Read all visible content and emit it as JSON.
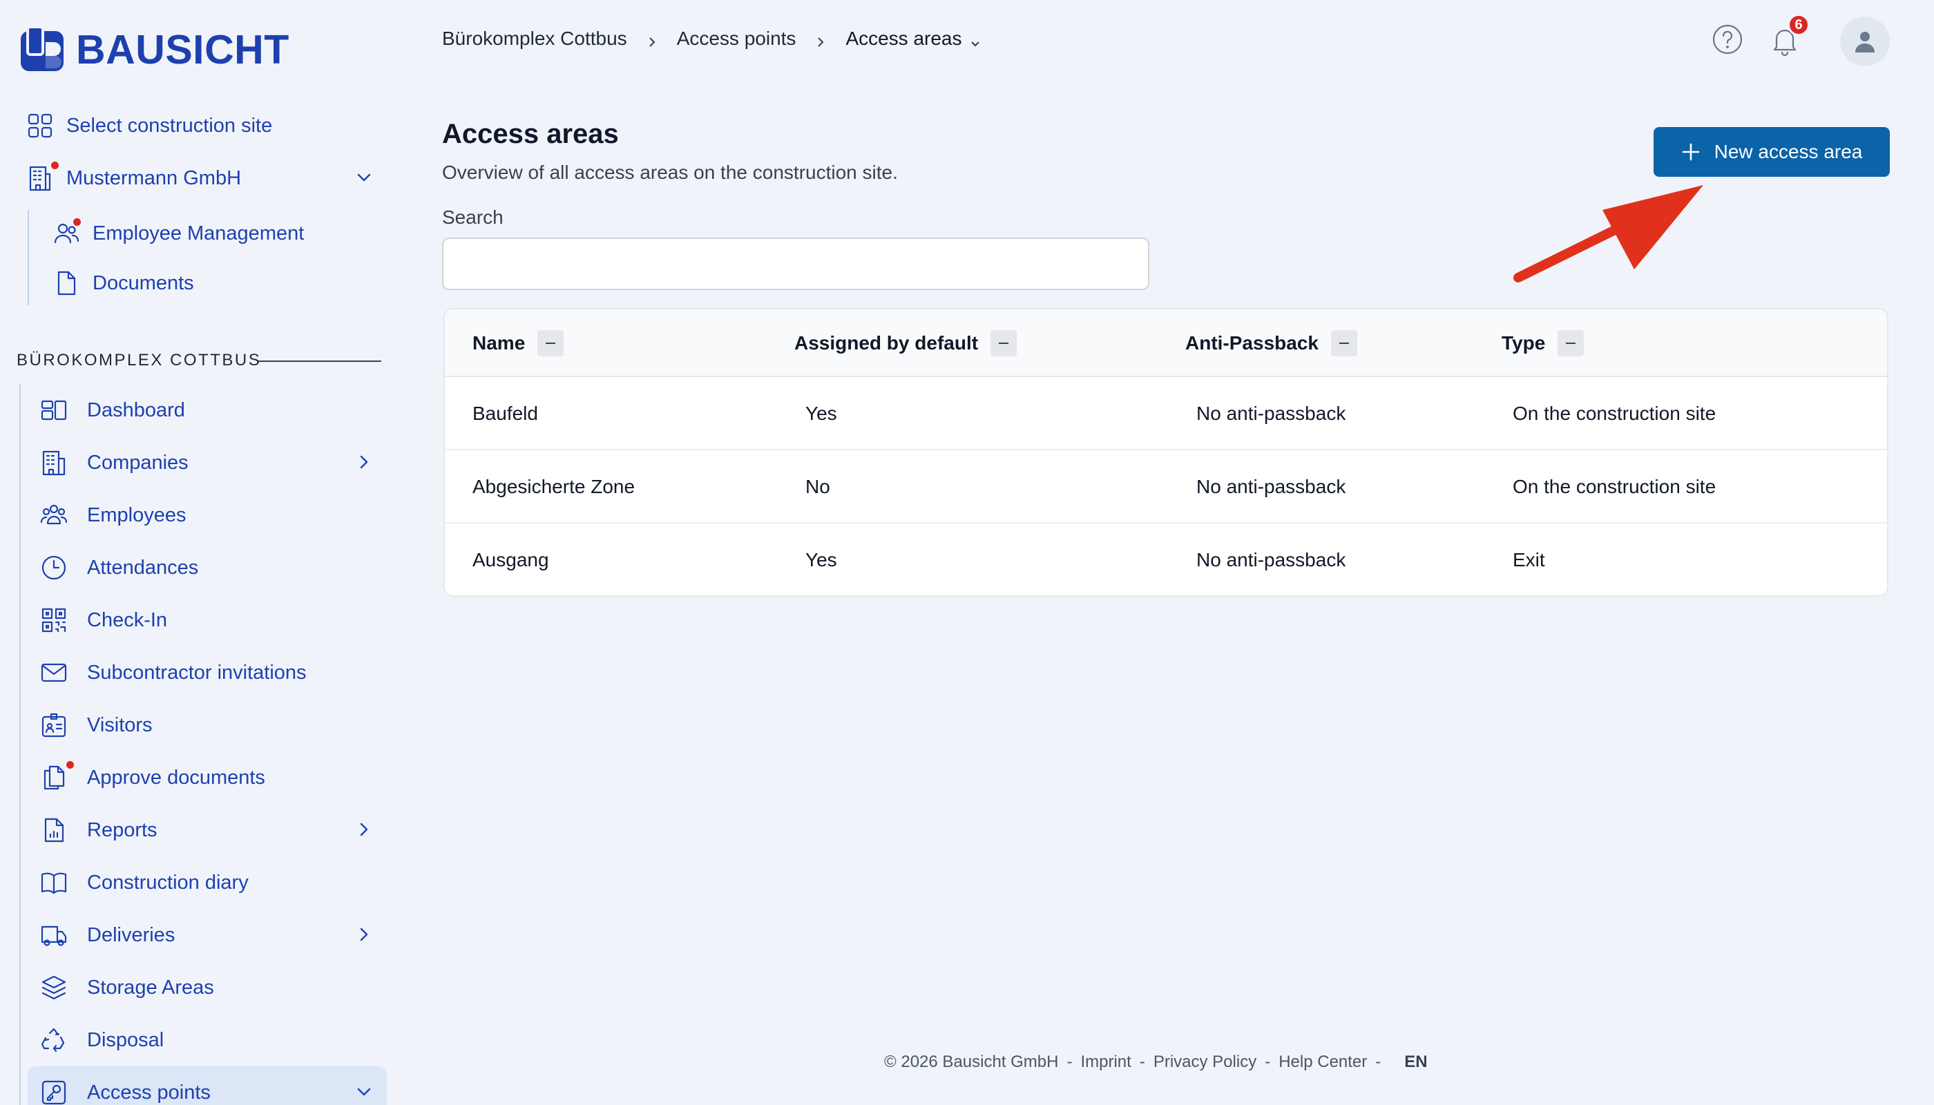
{
  "brand": {
    "name": "BAUSICHT",
    "color": "#1e40af"
  },
  "sidebar": {
    "select_site": "Select construction site",
    "company": "Mustermann GmbH",
    "company_children": [
      "Employee Management",
      "Documents"
    ],
    "section_title": "BÜROKOMPLEX COTTBUS",
    "items": [
      {
        "label": "Dashboard",
        "icon": "dashboard-icon"
      },
      {
        "label": "Companies",
        "icon": "building-icon",
        "expandable": true
      },
      {
        "label": "Employees",
        "icon": "users-icon"
      },
      {
        "label": "Attendances",
        "icon": "clock-icon"
      },
      {
        "label": "Check-In",
        "icon": "qr-code-icon"
      },
      {
        "label": "Subcontractor invitations",
        "icon": "envelope-icon"
      },
      {
        "label": "Visitors",
        "icon": "id-badge-icon"
      },
      {
        "label": "Approve documents",
        "icon": "documents-icon",
        "notification": true
      },
      {
        "label": "Reports",
        "icon": "report-icon",
        "expandable": true
      },
      {
        "label": "Construction diary",
        "icon": "book-icon"
      },
      {
        "label": "Deliveries",
        "icon": "truck-icon",
        "expandable": true
      },
      {
        "label": "Storage Areas",
        "icon": "layers-icon"
      },
      {
        "label": "Disposal",
        "icon": "recycle-icon"
      },
      {
        "label": "Access points",
        "icon": "key-icon",
        "active": true
      }
    ]
  },
  "breadcrumb": [
    "Bürokomplex Cottbus",
    "Access points",
    "Access areas"
  ],
  "header": {
    "notifications_count": "6"
  },
  "main": {
    "title": "Access areas",
    "subtitle": "Overview of all access areas on the construction site.",
    "search_label": "Search",
    "search_value": "",
    "new_button": "New access area"
  },
  "table": {
    "columns": [
      "Name",
      "Assigned by default",
      "Anti-Passback",
      "Type"
    ],
    "rows": [
      [
        "Baufeld",
        "Yes",
        "No anti-passback",
        "On the construction site"
      ],
      [
        "Abgesicherte Zone",
        "No",
        "No anti-passback",
        "On the construction site"
      ],
      [
        "Ausgang",
        "Yes",
        "No anti-passback",
        "Exit"
      ]
    ]
  },
  "footer": {
    "copyright": "© 2026 Bausicht GmbH",
    "links": [
      "Imprint",
      "Privacy Policy",
      "Help Center"
    ],
    "language": "EN"
  },
  "colors": {
    "primary_button": "#0b63a8",
    "nav_text": "#1e40af",
    "notification": "#dc2626",
    "annotation_arrow": "#e0311c"
  }
}
